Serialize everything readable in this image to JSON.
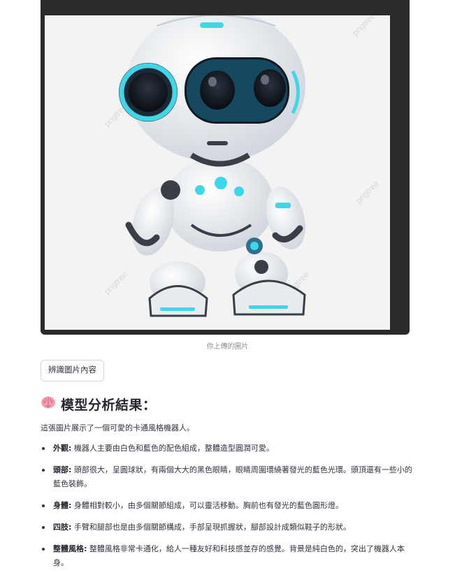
{
  "image": {
    "caption": "你上傳的圖片",
    "watermark": "pngtree"
  },
  "analyze_button": {
    "label": "辨識圖片內容"
  },
  "result": {
    "icon": "brain-emoji",
    "title": "模型分析結果：",
    "intro": "這張圖片展示了一個可愛的卡通風格機器人。",
    "items": [
      {
        "term": "外觀:",
        "text": "機器人主要由白色和藍色的配色組成，整體造型圓潤可愛。"
      },
      {
        "term": "頭部:",
        "text": "頭部很大，呈圓球狀，有兩個大大的黑色眼睛，眼睛周圍環繞著發光的藍色光環。頭頂還有一些小的藍色裝飾。"
      },
      {
        "term": "身體:",
        "text": "身體相對較小，由多個關節組成，可以靈活移動。胸前也有發光的藍色圓形燈。"
      },
      {
        "term": "四肢:",
        "text": "手臂和腿部也是由多個關節構成，手部呈現抓握狀，腳部設計成類似鞋子的形狀。"
      },
      {
        "term": "整體風格:",
        "text": "整體風格非常卡通化，給人一種友好和科技感並存的感覺。背景是純白色的，突出了機器人本身。"
      }
    ]
  },
  "colors": {
    "accent_glow": "#3fd6e8",
    "robot_white": "#f4f6f8",
    "robot_dark": "#3a3f47"
  }
}
